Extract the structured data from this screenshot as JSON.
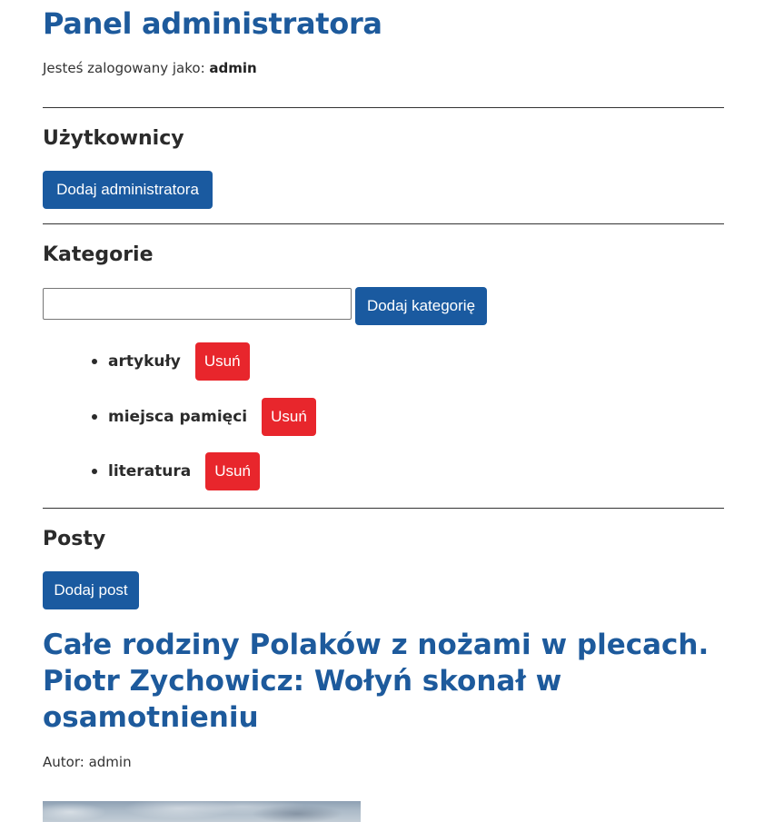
{
  "header": {
    "title": "Panel administratora",
    "login_prefix": "Jesteś zalogowany jako:",
    "username": "admin"
  },
  "users": {
    "title": "Użytkownicy",
    "add_admin_label": "Dodaj administratora"
  },
  "categories": {
    "title": "Kategorie",
    "input_value": "",
    "input_placeholder": "",
    "add_label": "Dodaj kategorię",
    "items": [
      {
        "label": "artykuły",
        "delete_label": "Usuń"
      },
      {
        "label": "miejsca pamięci",
        "delete_label": "Usuń"
      },
      {
        "label": "literatura",
        "delete_label": "Usuń"
      }
    ]
  },
  "posts": {
    "title": "Posty",
    "add_label": "Dodaj post",
    "items": [
      {
        "title": "Całe rodziny Polaków z nożami w plecach. Piotr Zychowicz: Wołyń skonał w osamotnieniu",
        "author_prefix": "Autor:",
        "author": "admin"
      }
    ]
  },
  "colors": {
    "primary": "#1a5aa0",
    "heading_blue": "#1d5a9c",
    "danger": "#e8262c",
    "text": "#333333"
  }
}
